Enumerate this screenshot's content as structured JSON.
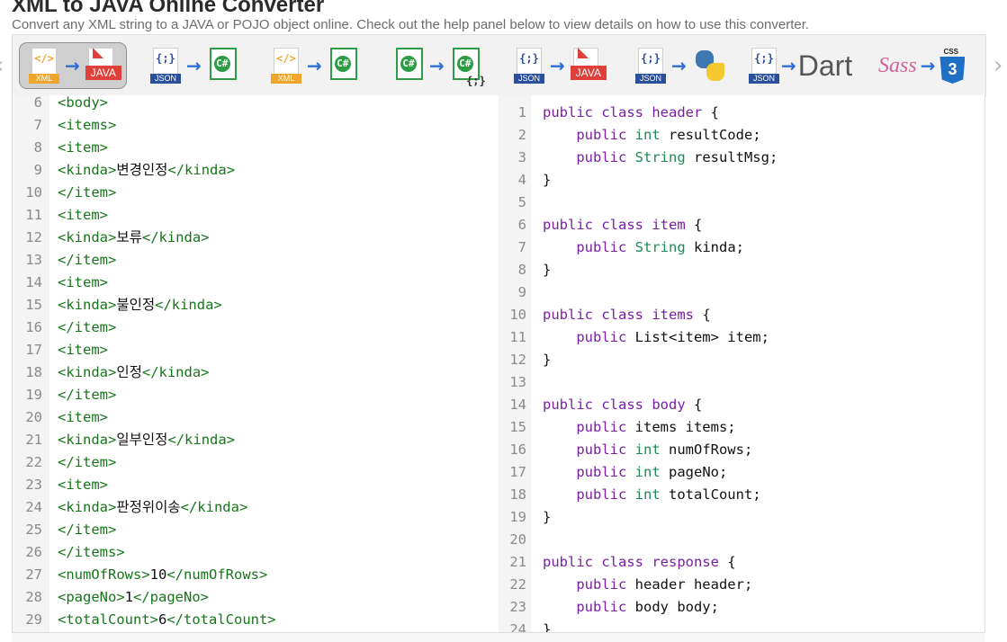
{
  "header": {
    "title": "XML to JAVA Online Converter",
    "subtitle": "Convert any XML string to a JAVA or POJO object online. Check out the help panel below to view details on how to use this converter."
  },
  "toolbar": {
    "tools": [
      {
        "name": "xml-to-java",
        "from": "XML",
        "to": "JAVA",
        "active": true
      },
      {
        "name": "json-to-csharp",
        "from": "JSON",
        "to": "C#",
        "active": false
      },
      {
        "name": "xml-to-csharp",
        "from": "XML",
        "to": "C#",
        "active": false
      },
      {
        "name": "csharp-to-json",
        "from": "C#",
        "to": "{;}",
        "active": false
      },
      {
        "name": "json-to-java",
        "from": "JSON",
        "to": "JAVA",
        "active": false
      },
      {
        "name": "json-to-python",
        "from": "JSON",
        "to": "Python",
        "active": false
      },
      {
        "name": "json-to-dart",
        "from": "JSON",
        "to": "Dart",
        "active": false
      },
      {
        "name": "sass-to-css",
        "from": "Sass",
        "to": "CSS3",
        "active": false
      }
    ],
    "labels": {
      "xml": "XML",
      "json": "JSON",
      "java": "JAVA",
      "xml_glyph": "</>",
      "json_glyph": "{;}",
      "cs_glyph": "C#",
      "cs_brace": "{;}",
      "dart": "Dart",
      "sass": "Sass",
      "css_cap": "CSS",
      "css_num": "3",
      "arrow": "→",
      "dart_arrow": "→"
    },
    "nav_prev": "‹",
    "nav_next": "›"
  },
  "left_editor": {
    "lines": [
      {
        "n": "6",
        "code": "<body>",
        "kind": "tag"
      },
      {
        "n": "7",
        "code": "<items>",
        "kind": "tag"
      },
      {
        "n": "8",
        "code": "<item>",
        "kind": "tag"
      },
      {
        "n": "9",
        "open": "<kinda>",
        "text": "변경인정",
        "close": "</kinda>",
        "kind": "elem"
      },
      {
        "n": "10",
        "code": "</item>",
        "kind": "tag"
      },
      {
        "n": "11",
        "code": "<item>",
        "kind": "tag"
      },
      {
        "n": "12",
        "open": "<kinda>",
        "text": "보류",
        "close": "</kinda>",
        "kind": "elem"
      },
      {
        "n": "13",
        "code": "</item>",
        "kind": "tag"
      },
      {
        "n": "14",
        "code": "<item>",
        "kind": "tag"
      },
      {
        "n": "15",
        "open": "<kinda>",
        "text": "불인정",
        "close": "</kinda>",
        "kind": "elem"
      },
      {
        "n": "16",
        "code": "</item>",
        "kind": "tag"
      },
      {
        "n": "17",
        "code": "<item>",
        "kind": "tag"
      },
      {
        "n": "18",
        "open": "<kinda>",
        "text": "인정",
        "close": "</kinda>",
        "kind": "elem"
      },
      {
        "n": "19",
        "code": "</item>",
        "kind": "tag"
      },
      {
        "n": "20",
        "code": "<item>",
        "kind": "tag"
      },
      {
        "n": "21",
        "open": "<kinda>",
        "text": "일부인정",
        "close": "</kinda>",
        "kind": "elem"
      },
      {
        "n": "22",
        "code": "</item>",
        "kind": "tag"
      },
      {
        "n": "23",
        "code": "<item>",
        "kind": "tag"
      },
      {
        "n": "24",
        "open": "<kinda>",
        "text": "판정위이송",
        "close": "</kinda>",
        "kind": "elem"
      },
      {
        "n": "25",
        "code": "</item>",
        "kind": "tag"
      },
      {
        "n": "26",
        "code": "</items>",
        "kind": "tag"
      },
      {
        "n": "27",
        "open": "<numOfRows>",
        "text": "10",
        "close": "</numOfRows>",
        "kind": "elem"
      },
      {
        "n": "28",
        "open": "<pageNo>",
        "text": "1",
        "close": "</pageNo>",
        "kind": "elem"
      },
      {
        "n": "29",
        "open": "<totalCount>",
        "text": "6",
        "close": "</totalCount>",
        "kind": "elem"
      }
    ]
  },
  "right_editor": {
    "lines": [
      {
        "n": "1",
        "tokens": [
          [
            "kw",
            "public "
          ],
          [
            "kw",
            "class "
          ],
          [
            "cn",
            "header"
          ],
          [
            "pl",
            " {"
          ]
        ]
      },
      {
        "n": "2",
        "tokens": [
          [
            "pl",
            "    "
          ],
          [
            "kw",
            "public "
          ],
          [
            "ty",
            "int"
          ],
          [
            "pl",
            " resultCode;"
          ]
        ]
      },
      {
        "n": "3",
        "tokens": [
          [
            "pl",
            "    "
          ],
          [
            "kw",
            "public "
          ],
          [
            "ty",
            "String"
          ],
          [
            "pl",
            " resultMsg;"
          ]
        ]
      },
      {
        "n": "4",
        "tokens": [
          [
            "pl",
            "}"
          ]
        ]
      },
      {
        "n": "5",
        "tokens": []
      },
      {
        "n": "6",
        "tokens": [
          [
            "kw",
            "public "
          ],
          [
            "kw",
            "class "
          ],
          [
            "cn",
            "item"
          ],
          [
            "pl",
            " {"
          ]
        ]
      },
      {
        "n": "7",
        "tokens": [
          [
            "pl",
            "    "
          ],
          [
            "kw",
            "public "
          ],
          [
            "ty",
            "String"
          ],
          [
            "pl",
            " kinda;"
          ]
        ]
      },
      {
        "n": "8",
        "tokens": [
          [
            "pl",
            "}"
          ]
        ]
      },
      {
        "n": "9",
        "tokens": []
      },
      {
        "n": "10",
        "tokens": [
          [
            "kw",
            "public "
          ],
          [
            "kw",
            "class "
          ],
          [
            "cn",
            "items"
          ],
          [
            "pl",
            " {"
          ]
        ]
      },
      {
        "n": "11",
        "tokens": [
          [
            "pl",
            "    "
          ],
          [
            "kw",
            "public "
          ],
          [
            "pl",
            "List<item> item;"
          ]
        ]
      },
      {
        "n": "12",
        "tokens": [
          [
            "pl",
            "}"
          ]
        ]
      },
      {
        "n": "13",
        "tokens": []
      },
      {
        "n": "14",
        "tokens": [
          [
            "kw",
            "public "
          ],
          [
            "kw",
            "class "
          ],
          [
            "cn",
            "body"
          ],
          [
            "pl",
            " {"
          ]
        ]
      },
      {
        "n": "15",
        "tokens": [
          [
            "pl",
            "    "
          ],
          [
            "kw",
            "public "
          ],
          [
            "pl",
            "items items;"
          ]
        ]
      },
      {
        "n": "16",
        "tokens": [
          [
            "pl",
            "    "
          ],
          [
            "kw",
            "public "
          ],
          [
            "ty",
            "int"
          ],
          [
            "pl",
            " numOfRows;"
          ]
        ]
      },
      {
        "n": "17",
        "tokens": [
          [
            "pl",
            "    "
          ],
          [
            "kw",
            "public "
          ],
          [
            "ty",
            "int"
          ],
          [
            "pl",
            " pageNo;"
          ]
        ]
      },
      {
        "n": "18",
        "tokens": [
          [
            "pl",
            "    "
          ],
          [
            "kw",
            "public "
          ],
          [
            "ty",
            "int"
          ],
          [
            "pl",
            " totalCount;"
          ]
        ]
      },
      {
        "n": "19",
        "tokens": [
          [
            "pl",
            "}"
          ]
        ]
      },
      {
        "n": "20",
        "tokens": []
      },
      {
        "n": "21",
        "tokens": [
          [
            "kw",
            "public "
          ],
          [
            "kw",
            "class "
          ],
          [
            "cn",
            "response"
          ],
          [
            "pl",
            " {"
          ]
        ]
      },
      {
        "n": "22",
        "tokens": [
          [
            "pl",
            "    "
          ],
          [
            "kw",
            "public "
          ],
          [
            "pl",
            "header header;"
          ]
        ]
      },
      {
        "n": "23",
        "tokens": [
          [
            "pl",
            "    "
          ],
          [
            "kw",
            "public "
          ],
          [
            "pl",
            "body body;"
          ]
        ]
      },
      {
        "n": "24",
        "tokens": [
          [
            "pl",
            "}"
          ]
        ]
      }
    ]
  },
  "colors": {
    "tag": "#17761a",
    "keyword": "#7a1fa3",
    "type": "#1e8a5a",
    "arrow": "#2d6fd2"
  }
}
